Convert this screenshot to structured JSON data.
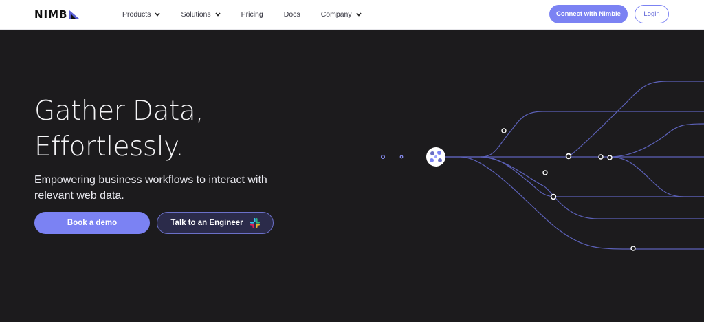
{
  "brand": {
    "name": "NIMB"
  },
  "nav": {
    "items": [
      {
        "label": "Products",
        "has_dropdown": true
      },
      {
        "label": "Solutions",
        "has_dropdown": true
      },
      {
        "label": "Pricing",
        "has_dropdown": false
      },
      {
        "label": "Docs",
        "has_dropdown": false
      },
      {
        "label": "Company",
        "has_dropdown": true
      }
    ],
    "connect_label": "Connect with Nimble",
    "login_label": "Login"
  },
  "hero": {
    "title_line1": "Gather Data,",
    "title_line2": "Effortlessly.",
    "subtitle": "Empowering business workflows to interact with relevant web data.",
    "primary_cta": "Book a demo",
    "secondary_cta": "Talk to an Engineer"
  },
  "colors": {
    "background": "#1c1b1d",
    "accent": "#7b82f3",
    "line": "#6a6fc4"
  },
  "icons": {
    "dropdown": "chevron-down-icon",
    "slack": "slack-icon",
    "hub": "nimble-hub-icon"
  }
}
